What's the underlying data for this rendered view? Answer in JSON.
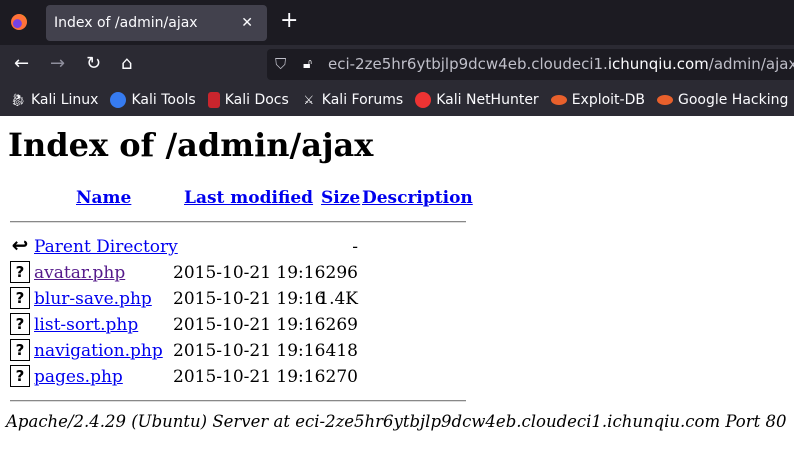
{
  "browser": {
    "tab_title": "Index of /admin/ajax",
    "url_prefix": "eci-2ze5hr6ytbjlp9dcw4eb.cloudeci1.",
    "url_domain": "ichunqiu.com",
    "url_path": "/admin/ajax/",
    "bookmarks": [
      {
        "label": "Kali Linux",
        "icon": "kali-dragon-icon"
      },
      {
        "label": "Kali Tools",
        "icon": "kali-tools-icon"
      },
      {
        "label": "Kali Docs",
        "icon": "kali-docs-icon"
      },
      {
        "label": "Kali Forums",
        "icon": "kali-forums-icon"
      },
      {
        "label": "Kali NetHunter",
        "icon": "nethunter-icon"
      },
      {
        "label": "Exploit-DB",
        "icon": "exploitdb-icon"
      },
      {
        "label": "Google Hacking DB",
        "icon": "ghdb-icon"
      }
    ]
  },
  "page": {
    "title": "Index of /admin/ajax",
    "headers": {
      "name": "Name",
      "modified": "Last modified",
      "size": "Size",
      "description": "Description"
    },
    "parent": {
      "name": "Parent Directory",
      "size": "-"
    },
    "files": [
      {
        "name": "avatar.php",
        "modified": "2015-10-21 19:16",
        "size": "296",
        "visited": true
      },
      {
        "name": "blur-save.php",
        "modified": "2015-10-21 19:16",
        "size": "1.4K"
      },
      {
        "name": "list-sort.php",
        "modified": "2015-10-21 19:16",
        "size": "269"
      },
      {
        "name": "navigation.php",
        "modified": "2015-10-21 19:16",
        "size": "418"
      },
      {
        "name": "pages.php",
        "modified": "2015-10-21 19:16",
        "size": "270"
      }
    ],
    "footer": "Apache/2.4.29 (Ubuntu) Server at eci-2ze5hr6ytbjlp9dcw4eb.cloudeci1.ichunqiu.com Port 80"
  }
}
